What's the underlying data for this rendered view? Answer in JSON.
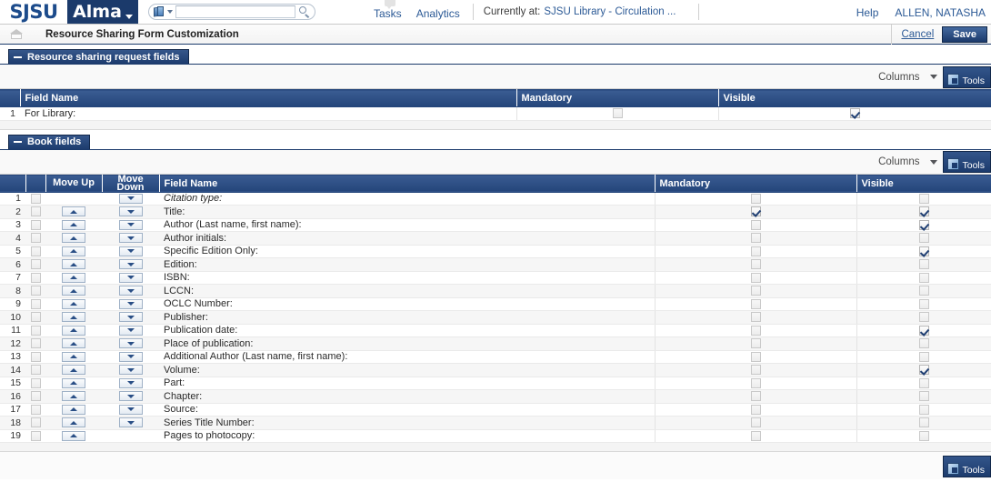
{
  "topbar": {
    "org_logo": "SJSU",
    "product_logo": "Alma",
    "search_placeholder": "",
    "search_value": "",
    "nav": [
      {
        "label": "Tasks",
        "name": "tasks"
      },
      {
        "label": "Analytics",
        "name": "analytics"
      }
    ],
    "currently_at_label": "Currently at:",
    "currently_at_value": "SJSU Library - Circulation ...",
    "help_label": "Help",
    "user_name": "ALLEN, NATASHA"
  },
  "titlebar": {
    "page_title": "Resource Sharing Form Customization",
    "cancel_label": "Cancel",
    "save_label": "Save"
  },
  "toolbar": {
    "columns_label": "Columns",
    "tools_label": "Tools"
  },
  "sections": [
    {
      "name": "resource-sharing-request-fields",
      "title": "Resource sharing request fields",
      "columns": [
        "",
        "Field Name",
        "Mandatory",
        "Visible"
      ],
      "rows": [
        {
          "index": "1",
          "field_name": "For Library:",
          "italic": false,
          "move_up": false,
          "move_down": false,
          "mandatory": false,
          "visible": true
        }
      ]
    },
    {
      "name": "book-fields",
      "title": "Book fields",
      "columns": [
        "",
        "",
        "Move Up",
        "Move Down",
        "Field Name",
        "Mandatory",
        "Visible"
      ],
      "move_down_header_line1": "Move",
      "move_down_header_line2": "Down",
      "rows": [
        {
          "index": "1",
          "field_name": "Citation type:",
          "italic": true,
          "select": false,
          "move_up": false,
          "move_down": true,
          "mandatory": false,
          "visible": false
        },
        {
          "index": "2",
          "field_name": "Title:",
          "italic": false,
          "select": false,
          "move_up": true,
          "move_down": true,
          "mandatory": true,
          "visible": true
        },
        {
          "index": "3",
          "field_name": "Author (Last name, first name):",
          "italic": false,
          "select": false,
          "move_up": true,
          "move_down": true,
          "mandatory": false,
          "visible": true
        },
        {
          "index": "4",
          "field_name": "Author initials:",
          "italic": false,
          "select": false,
          "move_up": true,
          "move_down": true,
          "mandatory": false,
          "visible": false
        },
        {
          "index": "5",
          "field_name": "Specific Edition Only:",
          "italic": false,
          "select": false,
          "move_up": true,
          "move_down": true,
          "mandatory": false,
          "visible": true
        },
        {
          "index": "6",
          "field_name": "Edition:",
          "italic": false,
          "select": false,
          "move_up": true,
          "move_down": true,
          "mandatory": false,
          "visible": false
        },
        {
          "index": "7",
          "field_name": "ISBN:",
          "italic": false,
          "select": false,
          "move_up": true,
          "move_down": true,
          "mandatory": false,
          "visible": false
        },
        {
          "index": "8",
          "field_name": "LCCN:",
          "italic": false,
          "select": false,
          "move_up": true,
          "move_down": true,
          "mandatory": false,
          "visible": false
        },
        {
          "index": "9",
          "field_name": "OCLC Number:",
          "italic": false,
          "select": false,
          "move_up": true,
          "move_down": true,
          "mandatory": false,
          "visible": false
        },
        {
          "index": "10",
          "field_name": "Publisher:",
          "italic": false,
          "select": false,
          "move_up": true,
          "move_down": true,
          "mandatory": false,
          "visible": false
        },
        {
          "index": "11",
          "field_name": "Publication date:",
          "italic": false,
          "select": false,
          "move_up": true,
          "move_down": true,
          "mandatory": false,
          "visible": true
        },
        {
          "index": "12",
          "field_name": "Place of publication:",
          "italic": false,
          "select": false,
          "move_up": true,
          "move_down": true,
          "mandatory": false,
          "visible": false
        },
        {
          "index": "13",
          "field_name": "Additional Author (Last name, first name):",
          "italic": false,
          "select": false,
          "move_up": true,
          "move_down": true,
          "mandatory": false,
          "visible": false
        },
        {
          "index": "14",
          "field_name": "Volume:",
          "italic": false,
          "select": false,
          "move_up": true,
          "move_down": true,
          "mandatory": false,
          "visible": true
        },
        {
          "index": "15",
          "field_name": "Part:",
          "italic": false,
          "select": false,
          "move_up": true,
          "move_down": true,
          "mandatory": false,
          "visible": false
        },
        {
          "index": "16",
          "field_name": "Chapter:",
          "italic": false,
          "select": false,
          "move_up": true,
          "move_down": true,
          "mandatory": false,
          "visible": false
        },
        {
          "index": "17",
          "field_name": "Source:",
          "italic": false,
          "select": false,
          "move_up": true,
          "move_down": true,
          "mandatory": false,
          "visible": false
        },
        {
          "index": "18",
          "field_name": "Series Title Number:",
          "italic": false,
          "select": false,
          "move_up": true,
          "move_down": true,
          "mandatory": false,
          "visible": false
        },
        {
          "index": "19",
          "field_name": "Pages to photocopy:",
          "italic": false,
          "select": false,
          "move_up": true,
          "move_down": false,
          "mandatory": false,
          "visible": false
        }
      ]
    }
  ],
  "colors": {
    "brand_dark_blue": "#1b3a6b",
    "header_blue": "#2c4f85",
    "link_blue": "#2c5a96",
    "sjsu_blue": "#1c4b8b"
  }
}
